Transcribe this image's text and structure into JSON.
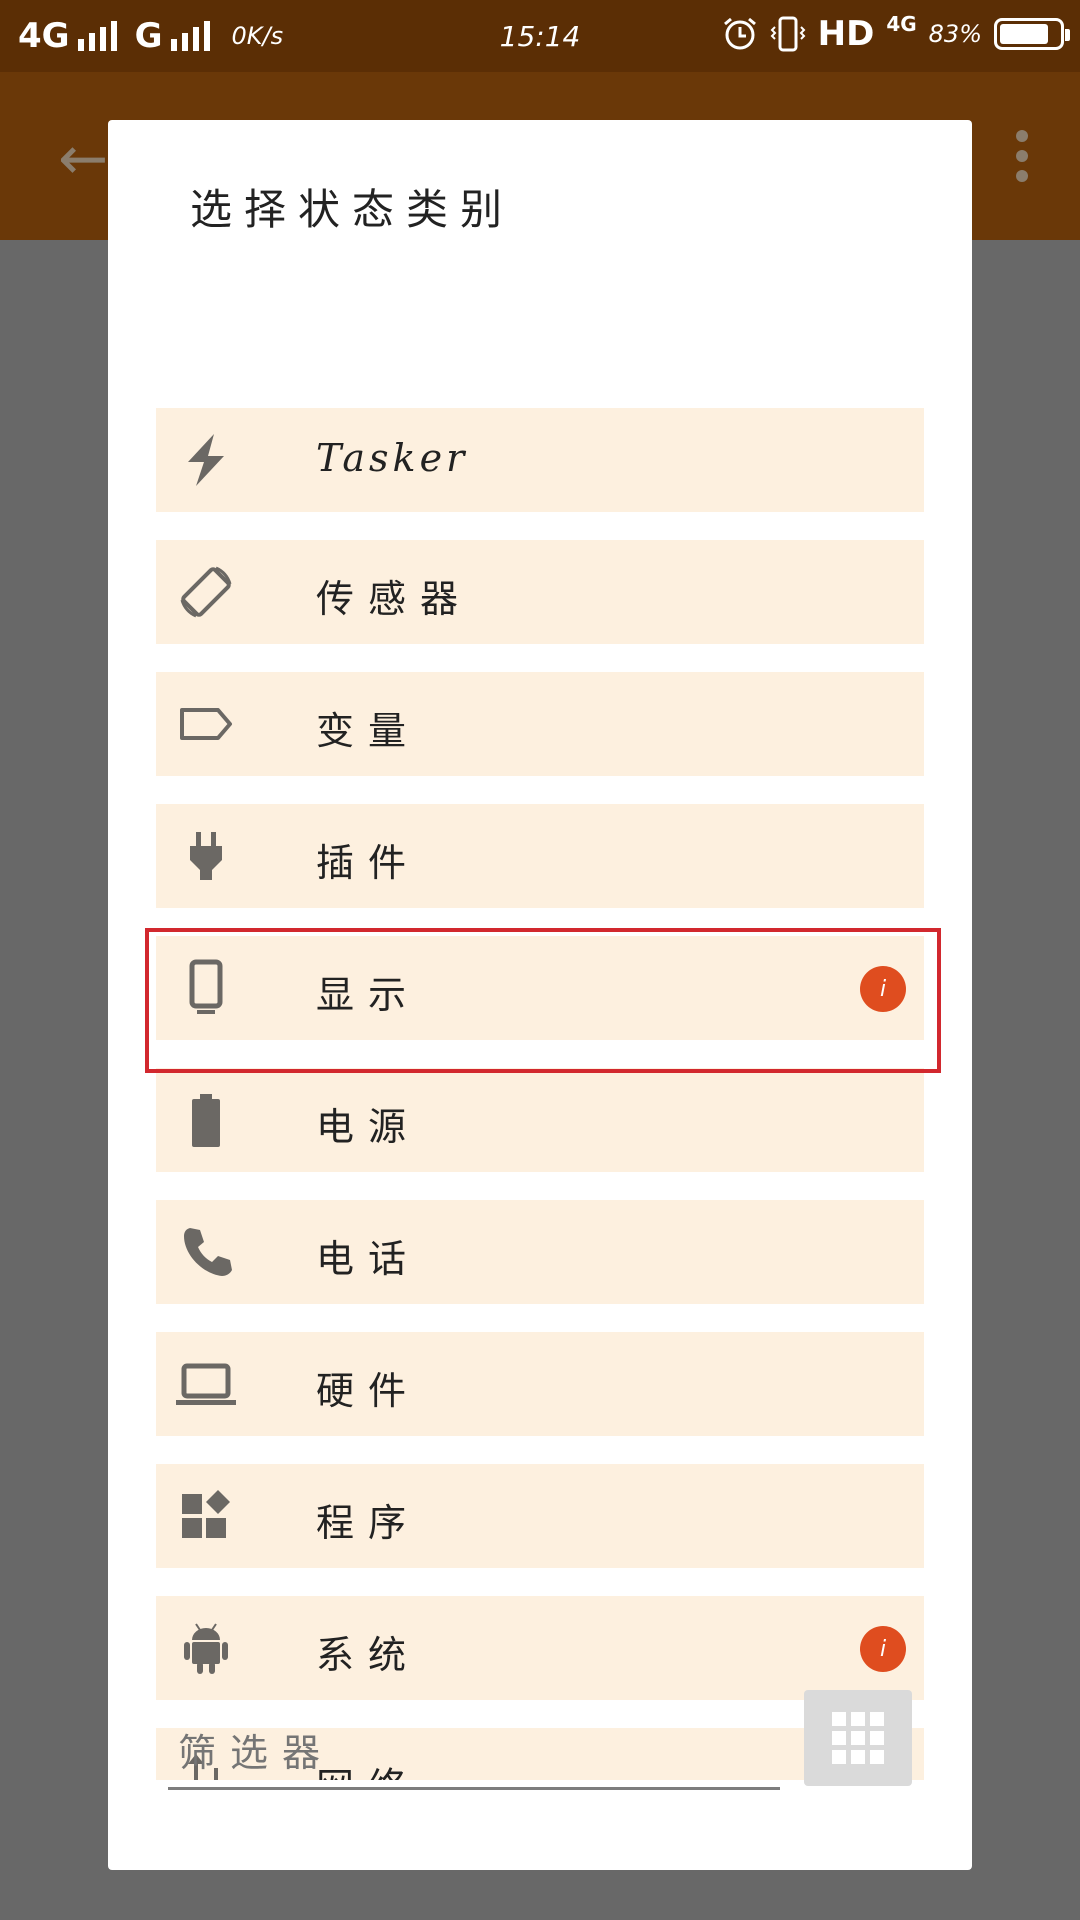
{
  "status_bar": {
    "network1": "4G",
    "network2": "G",
    "speed": "0K/s",
    "time": "15:14",
    "hd": "HD",
    "network3": "4G",
    "battery_percent": "83%",
    "battery_level": 0.83
  },
  "dialog": {
    "title": "选择状态类别",
    "filter_placeholder": "筛选器",
    "items": [
      {
        "label": "Tasker",
        "icon": "lightning-icon"
      },
      {
        "label": "传感器",
        "icon": "screen-rotation-icon"
      },
      {
        "label": "变量",
        "icon": "label-tag-icon"
      },
      {
        "label": "插件",
        "icon": "plug-icon"
      },
      {
        "label": "显示",
        "icon": "phone-display-icon",
        "badge": "i"
      },
      {
        "label": "电源",
        "icon": "battery-icon"
      },
      {
        "label": "电话",
        "icon": "phone-icon"
      },
      {
        "label": "硬件",
        "icon": "laptop-icon"
      },
      {
        "label": "程序",
        "icon": "apps-widgets-icon"
      },
      {
        "label": "系统",
        "icon": "android-icon",
        "badge": "i"
      },
      {
        "label": "网络",
        "icon": "network-arrows-icon"
      }
    ]
  },
  "colors": {
    "status_bar": "#5b2e05",
    "app_bar": "#6a3808",
    "row_background": "#fdf0df",
    "icon": "#6b6864",
    "badge": "#df4d1f",
    "highlight": "#d2282e"
  }
}
